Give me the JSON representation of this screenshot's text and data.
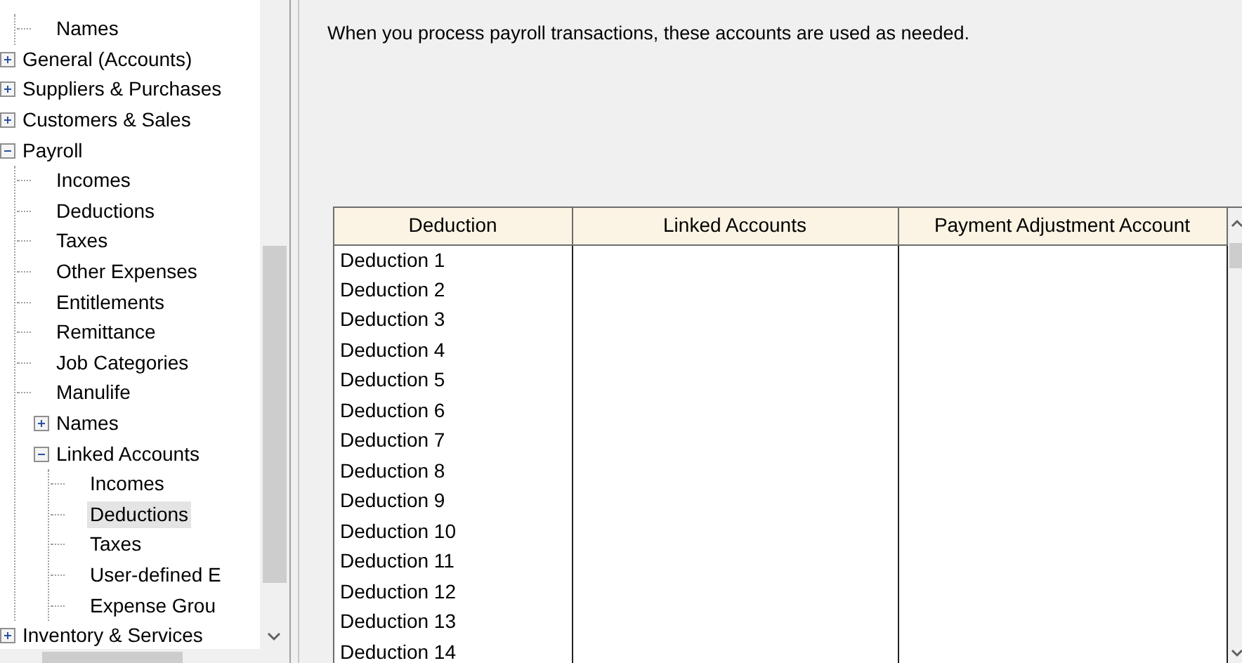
{
  "tree": [
    {
      "children": [
        {
          "label": "Names",
          "selected": false
        }
      ]
    },
    {
      "label": "General (Accounts)",
      "expanded": false,
      "selected": false
    },
    {
      "label": "Suppliers & Purchases",
      "expanded": false,
      "selected": false
    },
    {
      "label": "Customers & Sales",
      "expanded": false,
      "selected": false
    },
    {
      "label": "Payroll",
      "expanded": true,
      "selected": false,
      "children": [
        {
          "label": "Incomes",
          "selected": false
        },
        {
          "label": "Deductions",
          "selected": false
        },
        {
          "label": "Taxes",
          "selected": false
        },
        {
          "label": "Other Expenses",
          "selected": false
        },
        {
          "label": "Entitlements",
          "selected": false
        },
        {
          "label": "Remittance",
          "selected": false
        },
        {
          "label": "Job Categories",
          "selected": false
        },
        {
          "label": "Manulife",
          "selected": false
        },
        {
          "label": "Names",
          "expanded": false,
          "selected": false
        },
        {
          "label": "Linked Accounts",
          "expanded": true,
          "selected": false,
          "children": [
            {
              "label": "Incomes",
              "selected": false
            },
            {
              "label": "Deductions",
              "selected": true
            },
            {
              "label": "Taxes",
              "selected": false
            },
            {
              "label": "User-defined E",
              "selected": false
            },
            {
              "label": "Expense Grou",
              "selected": false
            }
          ]
        }
      ]
    },
    {
      "label": "Inventory & Services",
      "expanded": false,
      "selected": false
    }
  ],
  "description": "When you process payroll transactions, these accounts are used as needed.",
  "table": {
    "columns": [
      "Deduction",
      "Linked Accounts",
      "Payment Adjustment Account"
    ],
    "rows": [
      {
        "deduction": "Deduction 1"
      },
      {
        "deduction": "Deduction 2"
      },
      {
        "deduction": "Deduction 3"
      },
      {
        "deduction": "Deduction 4"
      },
      {
        "deduction": "Deduction 5"
      },
      {
        "deduction": "Deduction 6"
      },
      {
        "deduction": "Deduction 7"
      },
      {
        "deduction": "Deduction 8"
      },
      {
        "deduction": "Deduction 9"
      },
      {
        "deduction": "Deduction 10"
      },
      {
        "deduction": "Deduction 11"
      },
      {
        "deduction": "Deduction 12"
      },
      {
        "deduction": "Deduction 13"
      },
      {
        "deduction": "Deduction 14"
      }
    ]
  }
}
